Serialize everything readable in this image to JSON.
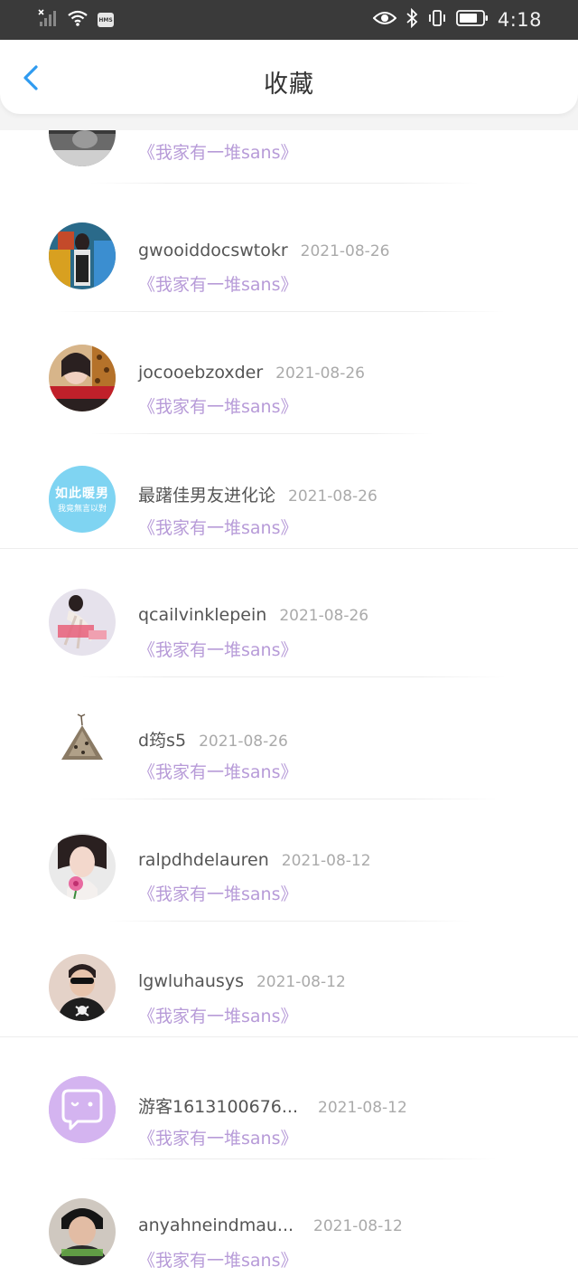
{
  "status_bar": {
    "hms_label": "HMS",
    "time": "4:18"
  },
  "header": {
    "title": "收藏"
  },
  "colors": {
    "accent": "#2f9bf0",
    "book_title": "#b79bd8",
    "status_bar": "#3a3a3a"
  },
  "favorites": [
    {
      "name": "",
      "date": "",
      "book": "《我家有一堆sans》",
      "avatar": "photo-avatar-partial"
    },
    {
      "name": "gwooiddocswtokr",
      "date": "2021-08-26",
      "book": "《我家有一堆sans》",
      "avatar": "photo-avatar"
    },
    {
      "name": "jocooebzoxder",
      "date": "2021-08-26",
      "book": "《我家有一堆sans》",
      "avatar": "photo-avatar"
    },
    {
      "name": "最躇佳男友进化论",
      "date": "2021-08-26",
      "book": "《我家有一堆sans》",
      "avatar": "text-avatar",
      "avatar_text_1": "如此暖男",
      "avatar_text_2": "我竟無言以對"
    },
    {
      "name": "qcailvinklepein",
      "date": "2021-08-26",
      "book": "《我家有一堆sans》",
      "avatar": "photo-avatar"
    },
    {
      "name": "d筠s5",
      "date": "2021-08-26",
      "book": "《我家有一堆sans》",
      "avatar": "photo-avatar"
    },
    {
      "name": "ralpdhdelauren",
      "date": "2021-08-12",
      "book": "《我家有一堆sans》",
      "avatar": "photo-avatar"
    },
    {
      "name": "lgwluhausys",
      "date": "2021-08-12",
      "book": "《我家有一堆sans》",
      "avatar": "photo-avatar"
    },
    {
      "name": "游客1613100676...",
      "date": "2021-08-12",
      "book": "《我家有一堆sans》",
      "avatar": "guest-chat-avatar"
    },
    {
      "name": "anyahneindmau...",
      "date": "2021-08-12",
      "book": "《我家有一堆sans》",
      "avatar": "photo-avatar"
    }
  ]
}
